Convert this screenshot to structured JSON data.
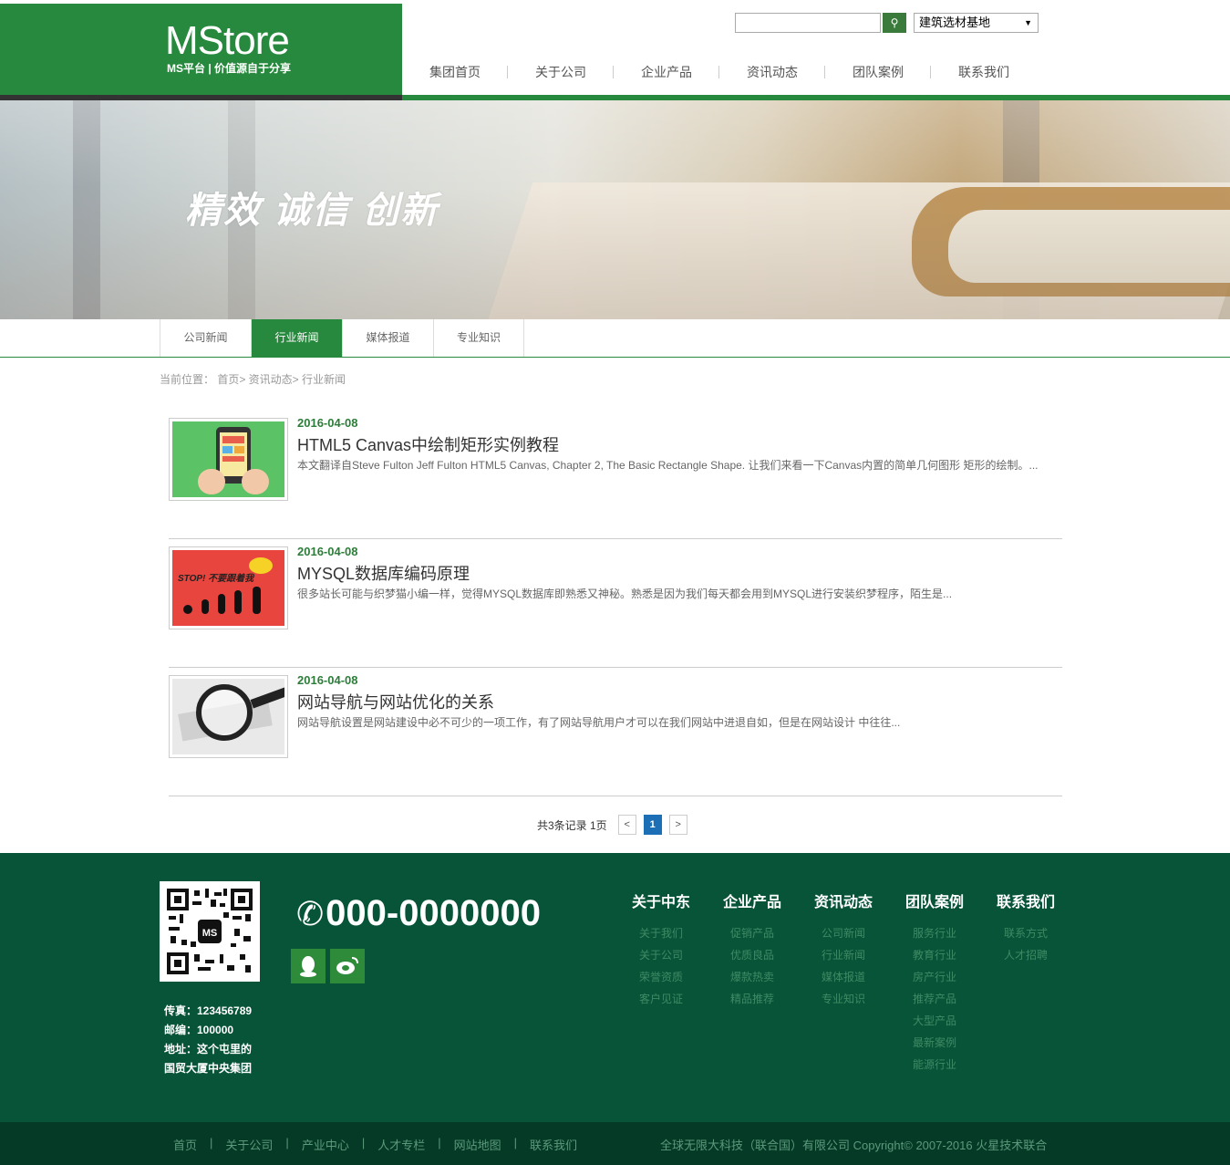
{
  "header": {
    "logo_title": "MStore",
    "logo_sub": "MS平台 | 价值源自于分享",
    "search_button_icon": "search-icon",
    "select_value": "建筑选材基地",
    "nav": [
      "集团首页",
      "关于公司",
      "企业产品",
      "资讯动态",
      "团队案例",
      "联系我们"
    ]
  },
  "banner": {
    "slogan": "精效  诚信  创新"
  },
  "subtabs": [
    "公司新闻",
    "行业新闻",
    "媒体报道",
    "专业知识"
  ],
  "breadcrumb": "当前位置： 首页> 资讯动态> 行业新闻",
  "news": [
    {
      "date": "2016-04-08",
      "title": "HTML5 Canvas中绘制矩形实例教程",
      "desc": "本文翻译自Steve Fulton Jeff Fulton HTML5 Canvas, Chapter 2, The Basic Rectangle Shape. 让我们来看一下Canvas内置的简单几何图形 矩形的绘制。..."
    },
    {
      "date": "2016-04-08",
      "title": "MYSQL数据库编码原理",
      "desc": "很多站长可能与织梦猫小编一样，觉得MYSQL数据库即熟悉又神秘。熟悉是因为我们每天都会用到MYSQL进行安装织梦程序，陌生是...",
      "thumb_text": "STOP! 不要跟着我"
    },
    {
      "date": "2016-04-08",
      "title": "网站导航与网站优化的关系",
      "desc": "网站导航设置是网站建设中必不可少的一项工作，有了网站导航用户才可以在我们网站中进退自如，但是在网站设计 中往往..."
    }
  ],
  "pager": {
    "info": "共3条记录 1页",
    "prev": "<",
    "current": "1",
    "next": ">"
  },
  "footer": {
    "phone": "000-0000000",
    "contact": [
      "传真：123456789",
      "邮编：100000",
      "地址：这个屯里的",
      "国贸大厦中央集团"
    ],
    "columns": [
      {
        "title": "关于中东",
        "links": [
          "关于我们",
          "关于公司",
          "荣誉资质",
          "客户见证"
        ]
      },
      {
        "title": "企业产品",
        "links": [
          "促销产品",
          "优质良品",
          "爆款热卖",
          "精品推荐"
        ]
      },
      {
        "title": "资讯动态",
        "links": [
          "公司新闻",
          "行业新闻",
          "媒体报道",
          "专业知识"
        ]
      },
      {
        "title": "团队案例",
        "links": [
          "服务行业",
          "教育行业",
          "房产行业",
          "推荐产品",
          "大型产品",
          "最新案例",
          "能源行业"
        ]
      },
      {
        "title": "联系我们",
        "links": [
          "联系方式",
          "人才招聘"
        ]
      }
    ],
    "bottom_links": [
      "首页",
      "关于公司",
      "产业中心",
      "人才专栏",
      "网站地图",
      "联系我们"
    ],
    "copyright": "全球无限大科技（联合国）有限公司 Copyright© 2007-2016 火星技术联合"
  },
  "colors": {
    "brand_green": "#27893d",
    "footer_green": "#075438",
    "pager_active": "#1d6fb5"
  }
}
